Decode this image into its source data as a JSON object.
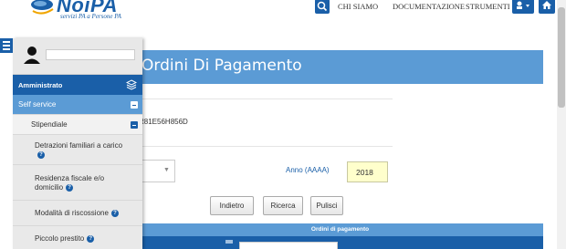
{
  "header": {
    "logo_text": "NoiPA",
    "logo_subtitle": "servizi PA a Persone PA",
    "nav": [
      "CHI SIAMO",
      "DOCUMENTAZIONE",
      "STRUMENTI"
    ],
    "user_label": "↑ ▾"
  },
  "page": {
    "title": "Ordini Di Pagamento",
    "code_value": "R81E56H856D"
  },
  "form": {
    "select_value": "",
    "anno_label": "Anno (AAAA)",
    "anno_value": "2018",
    "buttons": [
      "Indietro",
      "Ricerca",
      "Pulisci"
    ]
  },
  "table": {
    "header": "Ordini di pagamento"
  },
  "sidebar": {
    "section_title": "Amministrato",
    "items": [
      {
        "label": "Self service"
      },
      {
        "label": "Stipendiale"
      },
      {
        "label": "Detrazioni familiari a carico"
      },
      {
        "label": "Residenza fiscale e/o domicilio"
      },
      {
        "label": "Modalità di riscossione"
      },
      {
        "label": "Piccolo prestito"
      }
    ]
  },
  "colors": {
    "brand": "#1a5fa8",
    "title_bar": "#5b9bd5",
    "anno_field": "#ffffcc"
  }
}
